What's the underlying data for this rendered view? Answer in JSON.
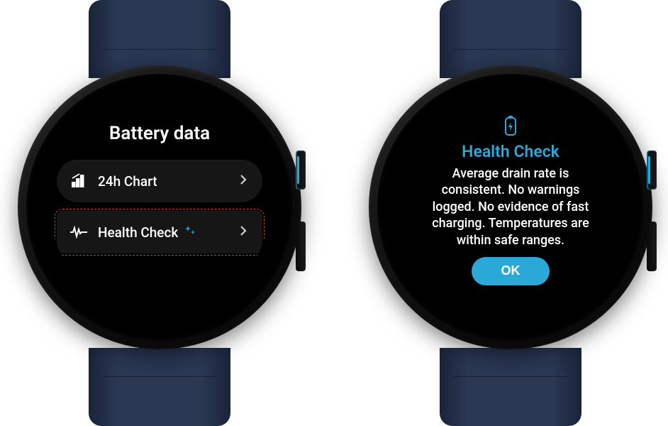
{
  "colors": {
    "accent": "#2aa8d8",
    "highlight_outline": "#d04040"
  },
  "left_watch": {
    "title": "Battery data",
    "items": [
      {
        "icon": "bar-chart-icon",
        "label": "24h Chart",
        "sparkle": false
      },
      {
        "icon": "heartbeat-icon",
        "label": "Health Check",
        "sparkle": true
      }
    ]
  },
  "right_watch": {
    "icon": "battery-health-icon",
    "title": "Health Check",
    "body": "Average drain rate is consistent. No warnings logged. No evidence of fast charging. Temperatures are within safe ranges.",
    "ok_label": "OK"
  }
}
